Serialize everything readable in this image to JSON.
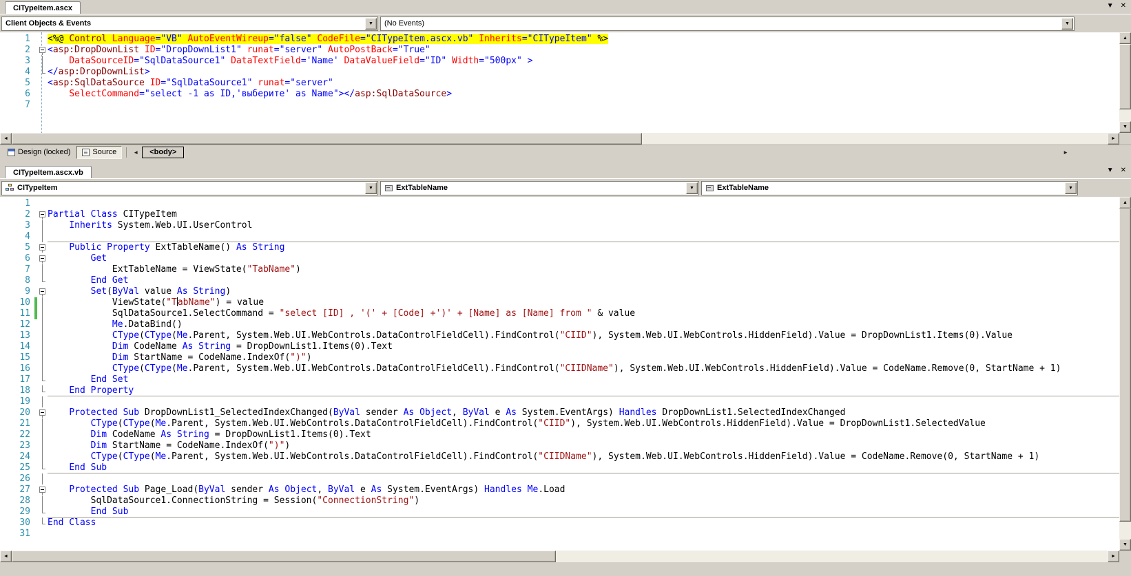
{
  "icons": {
    "dropdown": "▼",
    "close": "✕",
    "scroll_up": "▲",
    "scroll_down": "▼",
    "scroll_left": "◄",
    "scroll_right": "►",
    "nav_left": "◄",
    "nav_right": "►"
  },
  "colors": {
    "chrome": "#d4d0c8",
    "keyword": "#0000ff",
    "string": "#a31515",
    "tag_name": "#8b0000",
    "attribute": "#ff0000",
    "attr_value": "#0000ff",
    "line_number": "#2b91af",
    "directive_bg": "#ffff00",
    "change_bar": "#4fba4f"
  },
  "top": {
    "tab_label": "CITypeItem.ascx",
    "combo_objects": "Client Objects & Events",
    "combo_events": "(No Events)",
    "viewbar": {
      "design_label": "Design (locked)",
      "source_label": "Source",
      "tag_label": "<body>"
    },
    "lines": [
      {
        "n": 1,
        "f": "",
        "s": [
          [
            "pl hl",
            "<%@ "
          ],
          [
            "tg hl",
            "Control"
          ],
          [
            "at hl",
            " Language"
          ],
          [
            "dl hl",
            "="
          ],
          [
            "vl hl",
            "\"VB\""
          ],
          [
            "at hl",
            " AutoEventWireup"
          ],
          [
            "dl hl",
            "="
          ],
          [
            "vl hl",
            "\"false\""
          ],
          [
            "at hl",
            " CodeFile"
          ],
          [
            "dl hl",
            "="
          ],
          [
            "vl hl",
            "\"CITypeItem.ascx.vb\""
          ],
          [
            "at hl",
            " Inherits"
          ],
          [
            "dl hl",
            "="
          ],
          [
            "vl hl",
            "\"CITypeItem\""
          ],
          [
            "pl hl",
            " %>"
          ]
        ]
      },
      {
        "n": 2,
        "f": "-",
        "s": [
          [
            "dl",
            "<"
          ],
          [
            "tg",
            "asp:DropDownList"
          ],
          [
            "at",
            " ID"
          ],
          [
            "dl",
            "="
          ],
          [
            "vl",
            "\"DropDownList1\""
          ],
          [
            "at",
            " runat"
          ],
          [
            "dl",
            "="
          ],
          [
            "vl",
            "\"server\""
          ],
          [
            "at",
            " AutoPostBack"
          ],
          [
            "dl",
            "="
          ],
          [
            "vl",
            "\"True\""
          ]
        ]
      },
      {
        "n": 3,
        "f": "|",
        "s": [
          [
            "pl",
            "    "
          ],
          [
            "at",
            "DataSourceID"
          ],
          [
            "dl",
            "="
          ],
          [
            "vl",
            "\"SqlDataSource1\""
          ],
          [
            "at",
            " DataTextField"
          ],
          [
            "dl",
            "="
          ],
          [
            "vl",
            "'Name'"
          ],
          [
            "at",
            " DataValueField"
          ],
          [
            "dl",
            "="
          ],
          [
            "vl",
            "\"ID\""
          ],
          [
            "at",
            " Width"
          ],
          [
            "dl",
            "="
          ],
          [
            "vl",
            "\"500px\""
          ],
          [
            "dl",
            " >"
          ]
        ]
      },
      {
        "n": 4,
        "f": "L",
        "s": [
          [
            "dl",
            "</"
          ],
          [
            "tg",
            "asp:DropDownList"
          ],
          [
            "dl",
            ">"
          ]
        ]
      },
      {
        "n": 5,
        "f": "",
        "s": [
          [
            "dl",
            "<"
          ],
          [
            "tg",
            "asp:SqlDataSource"
          ],
          [
            "at",
            " ID"
          ],
          [
            "dl",
            "="
          ],
          [
            "vl",
            "\"SqlDataSource1\""
          ],
          [
            "at",
            " runat"
          ],
          [
            "dl",
            "="
          ],
          [
            "vl",
            "\"server\""
          ]
        ]
      },
      {
        "n": 6,
        "f": "",
        "s": [
          [
            "pl",
            "    "
          ],
          [
            "at",
            "SelectCommand"
          ],
          [
            "dl",
            "="
          ],
          [
            "vl",
            "\"select -1 as ID,'выберите' as Name\""
          ],
          [
            "dl",
            "></"
          ],
          [
            "tg",
            "asp:SqlDataSource"
          ],
          [
            "dl",
            ">"
          ]
        ]
      },
      {
        "n": 7,
        "f": "",
        "s": []
      }
    ]
  },
  "bottom": {
    "tab_label": "CITypeItem.ascx.vb",
    "combo_class": "CITypeItem",
    "combo_member": "ExtTableName",
    "combo_member2": "ExtTableName",
    "lines": [
      {
        "n": 1,
        "f": "",
        "s": []
      },
      {
        "n": 2,
        "f": "-",
        "s": [
          [
            "k",
            "Partial Class"
          ],
          [
            "pl",
            " CITypeItem"
          ]
        ]
      },
      {
        "n": 3,
        "f": "|",
        "s": [
          [
            "pl",
            "    "
          ],
          [
            "k",
            "Inherits"
          ],
          [
            "pl",
            " System.Web.UI.UserControl"
          ]
        ]
      },
      {
        "n": 4,
        "f": "|",
        "sep": true,
        "s": []
      },
      {
        "n": 5,
        "f": "-",
        "s": [
          [
            "pl",
            "    "
          ],
          [
            "k",
            "Public Property"
          ],
          [
            "pl",
            " ExtTableName() "
          ],
          [
            "k",
            "As String"
          ]
        ]
      },
      {
        "n": 6,
        "f": "-",
        "s": [
          [
            "pl",
            "        "
          ],
          [
            "k",
            "Get"
          ]
        ]
      },
      {
        "n": 7,
        "f": "|",
        "s": [
          [
            "pl",
            "            ExtTableName = ViewState("
          ],
          [
            "s",
            "\"TabName\""
          ],
          [
            "pl",
            ")"
          ]
        ]
      },
      {
        "n": 8,
        "f": "L",
        "s": [
          [
            "pl",
            "        "
          ],
          [
            "k",
            "End Get"
          ]
        ]
      },
      {
        "n": 9,
        "f": "-",
        "s": [
          [
            "pl",
            "        "
          ],
          [
            "k",
            "Set"
          ],
          [
            "pl",
            "("
          ],
          [
            "k",
            "ByVal"
          ],
          [
            "pl",
            " value "
          ],
          [
            "k",
            "As String"
          ],
          [
            "pl",
            ")"
          ]
        ]
      },
      {
        "n": 10,
        "f": "|",
        "chg": true,
        "s": [
          [
            "pl",
            "            ViewState("
          ],
          [
            "s",
            "\"T"
          ],
          [
            "caret",
            ""
          ],
          [
            "s",
            "abName\""
          ],
          [
            "pl",
            ") = value"
          ]
        ]
      },
      {
        "n": 11,
        "f": "|",
        "chg": true,
        "s": [
          [
            "pl",
            "            SqlDataSource1.SelectCommand = "
          ],
          [
            "s",
            "\"select [ID] , '(' + [Code] +')' + [Name] as [Name] from \""
          ],
          [
            "pl",
            " & value"
          ]
        ]
      },
      {
        "n": 12,
        "f": "|",
        "s": [
          [
            "pl",
            "            "
          ],
          [
            "k",
            "Me"
          ],
          [
            "pl",
            ".DataBind()"
          ]
        ]
      },
      {
        "n": 13,
        "f": "|",
        "s": [
          [
            "pl",
            "            "
          ],
          [
            "k",
            "CType"
          ],
          [
            "pl",
            "("
          ],
          [
            "k",
            "CType"
          ],
          [
            "pl",
            "("
          ],
          [
            "k",
            "Me"
          ],
          [
            "pl",
            ".Parent, System.Web.UI.WebControls.DataControlFieldCell).FindControl("
          ],
          [
            "s",
            "\"CIID\""
          ],
          [
            "pl",
            "), System.Web.UI.WebControls.HiddenField).Value = DropDownList1.Items(0).Value"
          ]
        ]
      },
      {
        "n": 14,
        "f": "|",
        "s": [
          [
            "pl",
            "            "
          ],
          [
            "k",
            "Dim"
          ],
          [
            "pl",
            " CodeName "
          ],
          [
            "k",
            "As String"
          ],
          [
            "pl",
            " = DropDownList1.Items(0).Text"
          ]
        ]
      },
      {
        "n": 15,
        "f": "|",
        "s": [
          [
            "pl",
            "            "
          ],
          [
            "k",
            "Dim"
          ],
          [
            "pl",
            " StartName = CodeName.IndexOf("
          ],
          [
            "s",
            "\")\""
          ],
          [
            "pl",
            ")"
          ]
        ]
      },
      {
        "n": 16,
        "f": "|",
        "s": [
          [
            "pl",
            "            "
          ],
          [
            "k",
            "CType"
          ],
          [
            "pl",
            "("
          ],
          [
            "k",
            "CType"
          ],
          [
            "pl",
            "("
          ],
          [
            "k",
            "Me"
          ],
          [
            "pl",
            ".Parent, System.Web.UI.WebControls.DataControlFieldCell).FindControl("
          ],
          [
            "s",
            "\"CIIDName\""
          ],
          [
            "pl",
            "), System.Web.UI.WebControls.HiddenField).Value = CodeName.Remove(0, StartName + 1)"
          ]
        ]
      },
      {
        "n": 17,
        "f": "L",
        "s": [
          [
            "pl",
            "        "
          ],
          [
            "k",
            "End Set"
          ]
        ]
      },
      {
        "n": 18,
        "f": "L",
        "sep": true,
        "s": [
          [
            "pl",
            "    "
          ],
          [
            "k",
            "End Property"
          ]
        ]
      },
      {
        "n": 19,
        "f": "|",
        "s": []
      },
      {
        "n": 20,
        "f": "-",
        "s": [
          [
            "pl",
            "    "
          ],
          [
            "k",
            "Protected Sub"
          ],
          [
            "pl",
            " DropDownList1_SelectedIndexChanged("
          ],
          [
            "k",
            "ByVal"
          ],
          [
            "pl",
            " sender "
          ],
          [
            "k",
            "As Object"
          ],
          [
            "pl",
            ", "
          ],
          [
            "k",
            "ByVal"
          ],
          [
            "pl",
            " e "
          ],
          [
            "k",
            "As"
          ],
          [
            "pl",
            " System.EventArgs) "
          ],
          [
            "k",
            "Handles"
          ],
          [
            "pl",
            " DropDownList1.SelectedIndexChanged"
          ]
        ]
      },
      {
        "n": 21,
        "f": "|",
        "s": [
          [
            "pl",
            "        "
          ],
          [
            "k",
            "CType"
          ],
          [
            "pl",
            "("
          ],
          [
            "k",
            "CType"
          ],
          [
            "pl",
            "("
          ],
          [
            "k",
            "Me"
          ],
          [
            "pl",
            ".Parent, System.Web.UI.WebControls.DataControlFieldCell).FindControl("
          ],
          [
            "s",
            "\"CIID\""
          ],
          [
            "pl",
            "), System.Web.UI.WebControls.HiddenField).Value = DropDownList1.SelectedValue"
          ]
        ]
      },
      {
        "n": 22,
        "f": "|",
        "s": [
          [
            "pl",
            "        "
          ],
          [
            "k",
            "Dim"
          ],
          [
            "pl",
            " CodeName "
          ],
          [
            "k",
            "As String"
          ],
          [
            "pl",
            " = DropDownList1.Items(0).Text"
          ]
        ]
      },
      {
        "n": 23,
        "f": "|",
        "s": [
          [
            "pl",
            "        "
          ],
          [
            "k",
            "Dim"
          ],
          [
            "pl",
            " StartName = CodeName.IndexOf("
          ],
          [
            "s",
            "\")\""
          ],
          [
            "pl",
            ")"
          ]
        ]
      },
      {
        "n": 24,
        "f": "|",
        "s": [
          [
            "pl",
            "        "
          ],
          [
            "k",
            "CType"
          ],
          [
            "pl",
            "("
          ],
          [
            "k",
            "CType"
          ],
          [
            "pl",
            "("
          ],
          [
            "k",
            "Me"
          ],
          [
            "pl",
            ".Parent, System.Web.UI.WebControls.DataControlFieldCell).FindControl("
          ],
          [
            "s",
            "\"CIIDName\""
          ],
          [
            "pl",
            "), System.Web.UI.WebControls.HiddenField).Value = CodeName.Remove(0, StartName + 1)"
          ]
        ]
      },
      {
        "n": 25,
        "f": "L",
        "sep": true,
        "s": [
          [
            "pl",
            "    "
          ],
          [
            "k",
            "End Sub"
          ]
        ]
      },
      {
        "n": 26,
        "f": "|",
        "s": []
      },
      {
        "n": 27,
        "f": "-",
        "s": [
          [
            "pl",
            "    "
          ],
          [
            "k",
            "Protected Sub"
          ],
          [
            "pl",
            " Page_Load("
          ],
          [
            "k",
            "ByVal"
          ],
          [
            "pl",
            " sender "
          ],
          [
            "k",
            "As Object"
          ],
          [
            "pl",
            ", "
          ],
          [
            "k",
            "ByVal"
          ],
          [
            "pl",
            " e "
          ],
          [
            "k",
            "As"
          ],
          [
            "pl",
            " System.EventArgs) "
          ],
          [
            "k",
            "Handles"
          ],
          [
            "pl",
            " "
          ],
          [
            "k",
            "Me"
          ],
          [
            "pl",
            ".Load"
          ]
        ]
      },
      {
        "n": 28,
        "f": "|",
        "s": [
          [
            "pl",
            "        SqlDataSource1.ConnectionString = Session("
          ],
          [
            "s",
            "\"ConnectionString\""
          ],
          [
            "pl",
            ")"
          ]
        ]
      },
      {
        "n": 29,
        "f": "L",
        "sep": true,
        "s": [
          [
            "pl",
            "        "
          ],
          [
            "k",
            "End Sub"
          ]
        ]
      },
      {
        "n": 30,
        "f": "L",
        "s": [
          [
            "k",
            "End Class"
          ]
        ]
      },
      {
        "n": 31,
        "f": "",
        "s": []
      }
    ]
  }
}
